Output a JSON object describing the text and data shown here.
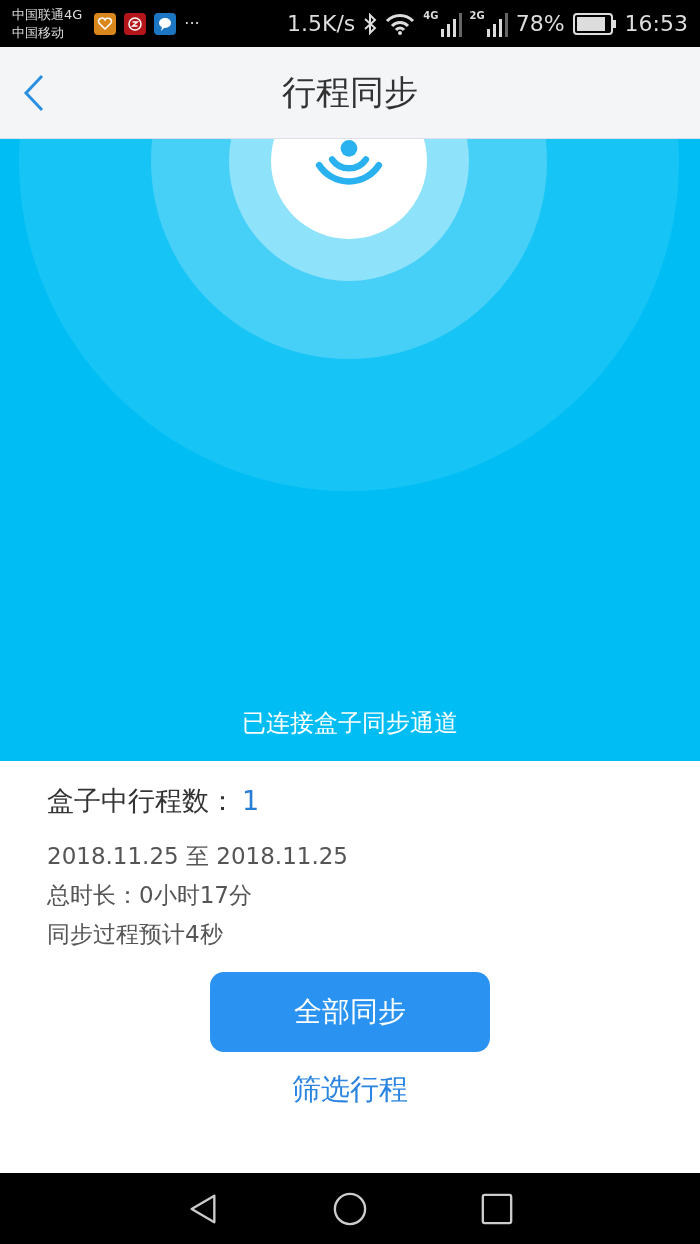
{
  "status_bar": {
    "carriers": [
      "中国联通4G",
      "中国移动"
    ],
    "more": "···",
    "speed": "1.5K/s",
    "signals": [
      {
        "network": "4G"
      },
      {
        "network": "2G"
      }
    ],
    "battery": "78%",
    "time": "16:53"
  },
  "nav": {
    "title": "行程同步"
  },
  "banner": {
    "status": "已连接盒子同步通道"
  },
  "summary": {
    "count_label": "盒子中行程数：",
    "count": "1",
    "lines": [
      "2018.11.25 至 2018.11.25",
      "总时长：0小时17分",
      "同步过程预计4秒"
    ]
  },
  "primary_button": "全部同步",
  "link": "筛选行程"
}
